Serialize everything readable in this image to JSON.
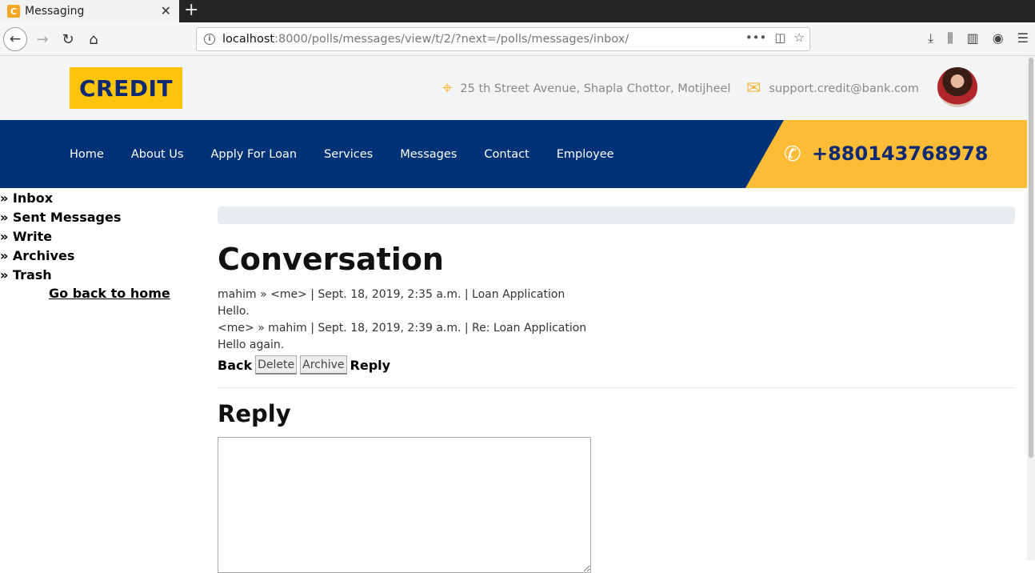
{
  "browser": {
    "tab_title": "Messaging",
    "tab_favicon": "C",
    "url_host": "localhost",
    "url_path": ":8000/polls/messages/view/t/2/?next=/polls/messages/inbox/"
  },
  "header": {
    "logo": "CREDIT",
    "address": "25 th Street Avenue, Shapla Chottor, Motijheel",
    "email": "support.credit@bank.com"
  },
  "nav": {
    "items": [
      "Home",
      "About Us",
      "Apply For Loan",
      "Services",
      "Messages",
      "Contact",
      "Employee"
    ],
    "phone": "+880143768978"
  },
  "sidebar": {
    "items": [
      "» Inbox",
      "» Sent Messages",
      "» Write",
      "» Archives",
      "» Trash"
    ],
    "go_home": "Go back to home"
  },
  "conversation": {
    "title": "Conversation",
    "messages": [
      {
        "meta": "mahim » <me> | Sept. 18, 2019, 2:35 a.m. | Loan Application",
        "body": "Hello."
      },
      {
        "meta": "<me> » mahim | Sept. 18, 2019, 2:39 a.m. | Re: Loan Application",
        "body": "Hello again."
      }
    ],
    "actions": {
      "back": "Back",
      "delete": "Delete",
      "archive": "Archive",
      "reply": "Reply"
    }
  },
  "reply": {
    "title": "Reply",
    "body_value": ""
  },
  "colors": {
    "navy": "#003278",
    "yellow": "#fec40a",
    "orange": "#fcbc36"
  }
}
